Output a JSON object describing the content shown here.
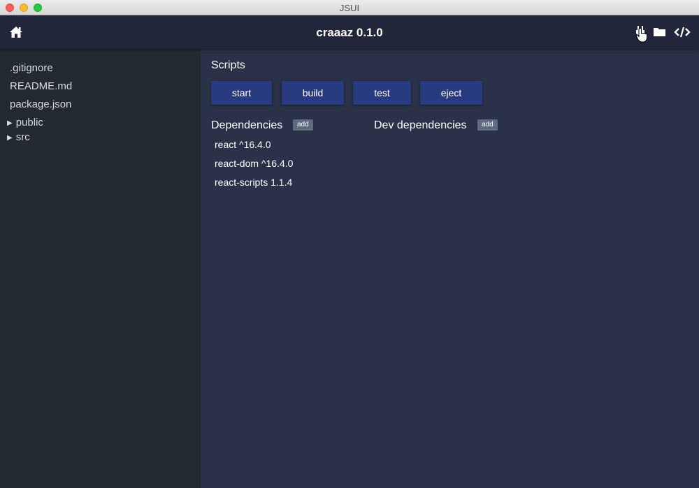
{
  "window": {
    "title": "JSUI"
  },
  "header": {
    "title": "craaaz 0.1.0",
    "icons": [
      "home-icon",
      "plug-icon",
      "folder-icon",
      "code-icon"
    ]
  },
  "sidebar": {
    "files": [
      ".gitignore",
      "README.md",
      "package.json"
    ],
    "folders": [
      "public",
      "src"
    ]
  },
  "main": {
    "scripts_title": "Scripts",
    "scripts": [
      "start",
      "build",
      "test",
      "eject"
    ],
    "dependencies_title": "Dependencies",
    "dev_dependencies_title": "Dev dependencies",
    "add_label": "add",
    "dependencies": [
      "react ^16.4.0",
      "react-dom ^16.4.0",
      "react-scripts 1.1.4"
    ]
  },
  "colors": {
    "header_bg": "#22263a",
    "sidebar_bg": "#222a30",
    "main_bg": "#2b3148",
    "button_bg": "#283a80",
    "add_button_bg": "#5d6a80"
  }
}
